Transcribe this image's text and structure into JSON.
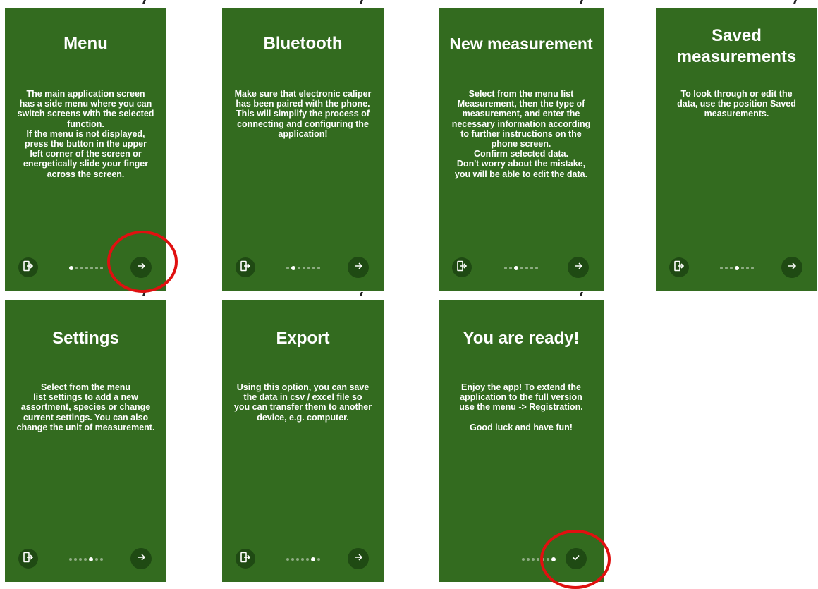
{
  "accent_color": "#336b1f",
  "button_color": "#1f4a13",
  "highlight_color": "#e01010",
  "screens": [
    {
      "title": "Menu",
      "body": "The main application screen\nhas a side menu where you can\nswitch screens with the selected\nfunction.\nIf the menu is not displayed,\npress the button in the upper\nleft corner of the screen or\nenergetically slide your finger\nacross the screen.",
      "active_dot": 0,
      "action_icon": "arrow-right-icon"
    },
    {
      "title": "Bluetooth",
      "body": "Make sure that electronic caliper\nhas been paired with the phone.\nThis will simplify the process of\nconnecting and configuring the\napplication!",
      "active_dot": 1,
      "action_icon": "arrow-right-icon"
    },
    {
      "title": "New measurement",
      "body": "Select from the menu list\nMeasurement, then the type of\nmeasurement, and enter the\nnecessary information according\nto further instructions on the\nphone screen.\nConfirm selected data.\nDon't worry about the mistake,\nyou will be able to edit the data.",
      "active_dot": 2,
      "action_icon": "arrow-right-icon"
    },
    {
      "title": "Saved\nmeasurements",
      "body": "To look through or edit the\ndata, use the position Saved\nmeasurements.",
      "active_dot": 3,
      "action_icon": "arrow-right-icon"
    },
    {
      "title": "Settings",
      "body": "Select from the menu\nlist settings to add a new\nassortment, species or change\ncurrent settings. You can also\nchange the unit of measurement.",
      "active_dot": 4,
      "action_icon": "arrow-right-icon"
    },
    {
      "title": "Export",
      "body": "Using this option, you can save\nthe data in csv / excel file so\nyou can transfer them to another\ndevice, e.g. computer.",
      "active_dot": 5,
      "action_icon": "arrow-right-icon"
    },
    {
      "title": "You are ready!",
      "body": "Enjoy the app! To extend the\napplication to the full version\nuse the menu -> Registration.\n\nGood luck and have fun!",
      "active_dot": 6,
      "action_icon": "check-icon"
    }
  ],
  "dot_count": 7,
  "skip_icon": "exit-door-icon"
}
